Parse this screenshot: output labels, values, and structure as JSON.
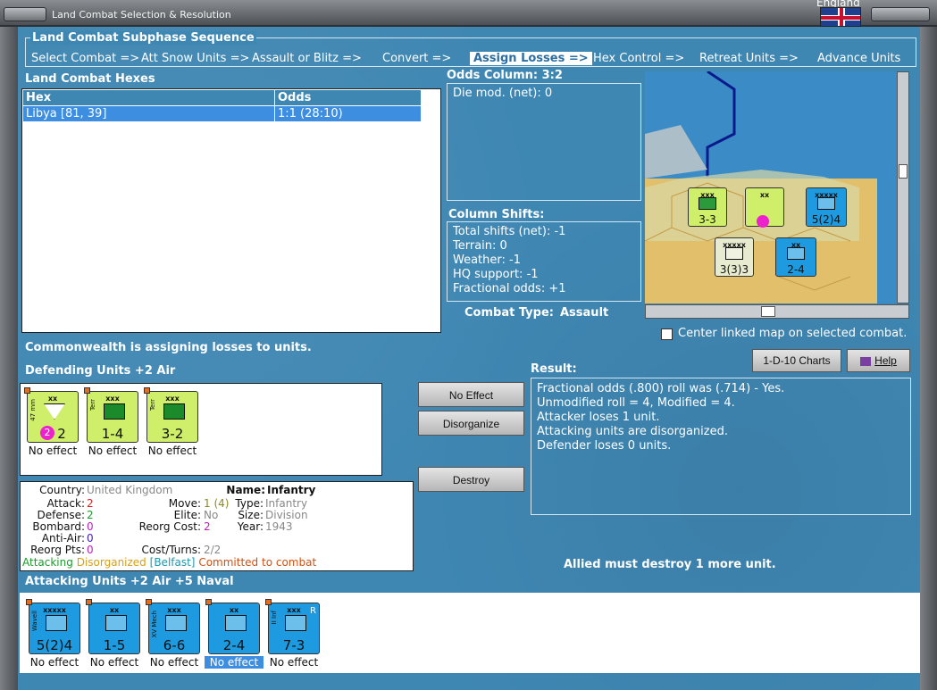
{
  "window": {
    "title": "Land Combat Selection & Resolution",
    "nation": "England",
    "colors": {
      "bg": "#3f87b3",
      "selection": "#3d8ee0",
      "defender": "#cfee6a",
      "attacker": "#1e9be0"
    }
  },
  "sequence": {
    "title": "Land Combat Subphase Sequence",
    "items": [
      {
        "label": "Select Combat =>"
      },
      {
        "label": "Att Snow Units =>"
      },
      {
        "label": "Assault or Blitz =>"
      },
      {
        "label": "Convert =>"
      },
      {
        "label": "Assign Losses =>",
        "selected": true
      },
      {
        "label": "Hex Control =>"
      },
      {
        "label": "Retreat Units =>"
      },
      {
        "label": "Advance Units"
      }
    ]
  },
  "hexes": {
    "title": "Land Combat Hexes",
    "headers": [
      "Hex",
      "Odds"
    ],
    "rows": [
      {
        "hex": "Libya [81, 39]",
        "odds": "1:1 (28:10)"
      }
    ]
  },
  "odds": {
    "title": "Odds Column: 3:2",
    "die_mod": "Die mod. (net): 0"
  },
  "shifts": {
    "title": "Column Shifts:",
    "lines": [
      "Total shifts (net): -1",
      "Terrain: 0",
      "Weather: -1",
      "HQ support: -1",
      "Fractional odds: +1"
    ]
  },
  "combat_type": {
    "label": "Combat Type:",
    "value": "Assault"
  },
  "center_map": {
    "label": "Center linked map on selected combat.",
    "checked": false
  },
  "status_line": "Commonwealth is assigning losses to units.",
  "defending": {
    "title": "Defending Units +2 Air",
    "units": [
      {
        "corps": "xx",
        "side": "47 mm",
        "stats": "2",
        "caption": "No effect",
        "badge": "2",
        "icon": "para-triangle-icon"
      },
      {
        "corps": "xxx",
        "side": "Terr",
        "stats": "1-4",
        "caption": "No effect",
        "icon": "territorial-icon"
      },
      {
        "corps": "xxx",
        "side": "Terr",
        "stats": "3-2",
        "caption": "No effect",
        "icon": "territorial-icon"
      }
    ]
  },
  "buttons": {
    "no_effect": "No Effect",
    "disorganize": "Disorganize",
    "destroy": "Destroy",
    "charts": "1-D-10 Charts",
    "help": "Help"
  },
  "result": {
    "title": "Result:",
    "lines": [
      "Fractional odds (.800) roll was (.714)  - Yes.",
      "Unmodified roll = 4, Modified = 4.",
      "Attacker loses 1 unit.",
      "Attacking units are disorganized.",
      "Defender loses 0 units."
    ],
    "must_destroy": "Allied must destroy 1 more unit."
  },
  "unit_info": {
    "country_k": "Country:",
    "country_v": "United Kingdom",
    "attack_k": "Attack:",
    "attack_v": "2",
    "defense_k": "Defense:",
    "defense_v": "2",
    "bombard_k": "Bombard:",
    "bombard_v": "0",
    "antiair_k": "Anti-Air:",
    "antiair_v": "0",
    "reorg_k": "Reorg Pts:",
    "reorg_v": "0",
    "name_k": "Name:",
    "name_v": "Infantry",
    "move_k": "Move:",
    "move_v": "1 (4)",
    "type_k": "Type:",
    "type_v": "Infantry",
    "elite_k": "Elite:",
    "elite_v": "No",
    "size_k": "Size:",
    "size_v": "Division",
    "reorgcost_k": "Reorg Cost:",
    "reorgcost_v": "2",
    "year_k": "Year:",
    "year_v": "1943",
    "costturns_k": "Cost/Turns:",
    "costturns_v": "2/2",
    "status_1": "Attacking",
    "status_2": "Disorganized",
    "status_3": "[Belfast]",
    "status_4": "Committed to combat"
  },
  "attacking": {
    "title": "Attacking Units +2 Air +5 Naval",
    "units": [
      {
        "corps": "xxxxx",
        "side": "Wavell",
        "stats": "5(2)4",
        "caption": "No effect",
        "icon": "hq-icon"
      },
      {
        "corps": "xx",
        "side": "",
        "stats": "1-5",
        "caption": "No effect",
        "icon": "infantry-icon"
      },
      {
        "corps": "xxx",
        "side": "XV Mech",
        "stats": "6-6",
        "caption": "No effect",
        "icon": "armor-icon"
      },
      {
        "corps": "xx",
        "side": "",
        "stats": "2-4",
        "caption": "No effect",
        "icon": "infantry-icon",
        "selected": true
      },
      {
        "corps": "xxx",
        "side": "II Inf",
        "stats": "7-3",
        "caption": "No effect",
        "icon": "infantry-icon",
        "badge": "R"
      }
    ]
  },
  "map": {
    "units": [
      {
        "corps": "xxx",
        "stats": "3-3",
        "stack": "2"
      },
      {
        "corps": "xx",
        "stats": "",
        "stack": "3"
      },
      {
        "corps": "xxxxx",
        "stats": "5(2)4",
        "stack": "3"
      },
      {
        "corps": "xxxxx",
        "stats": "3(3)3",
        "stack": ""
      },
      {
        "corps": "xx",
        "stats": "2-4",
        "stack": "2"
      }
    ]
  }
}
